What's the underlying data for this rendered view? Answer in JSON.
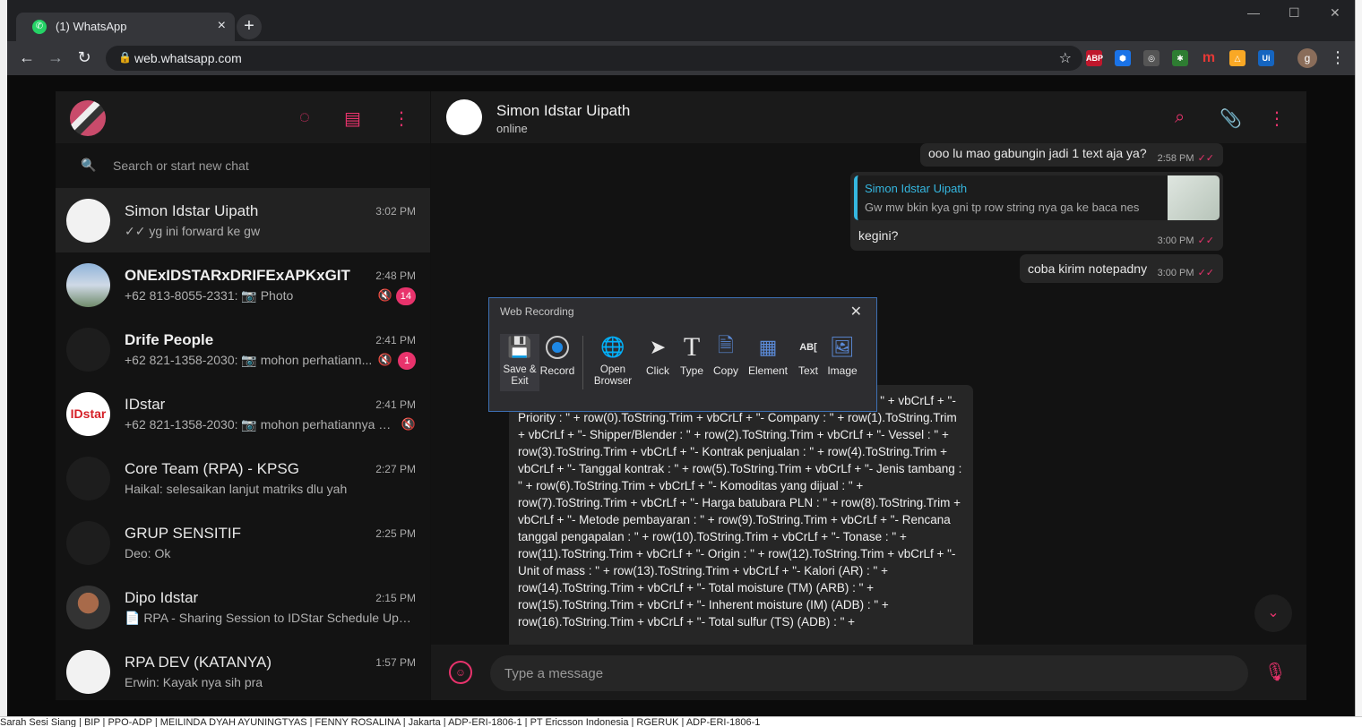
{
  "browser": {
    "tab_title": "(1) WhatsApp",
    "url": "web.whatsapp.com",
    "profile_initial": "g",
    "extensions": [
      "ABP",
      "⬢",
      "◎",
      "✱",
      "m",
      "△",
      "Ui"
    ]
  },
  "sidebar": {
    "search_placeholder": "Search or start new chat",
    "chats": [
      {
        "name": "Simon Idstar Uipath",
        "time": "3:02 PM",
        "preview": "✓✓ yg ini forward ke gw",
        "bold": false
      },
      {
        "name": "ONExIDSTARxDRIFExAPKxGIT",
        "time": "2:48 PM",
        "preview": "+62 813-8055-2331: 📷 Photo",
        "badge": "14",
        "bold": true
      },
      {
        "name": "Drife People",
        "time": "2:41 PM",
        "preview": "+62 821-1358-2030: 📷 mohon perhatiann...",
        "badge": "1",
        "bold": true
      },
      {
        "name": "IDstar",
        "time": "2:41 PM",
        "preview": "+62 821-1358-2030: 📷 mohon perhatiannya u...",
        "bold": false
      },
      {
        "name": "Core Team (RPA) - KPSG",
        "time": "2:27 PM",
        "preview": "Haikal: selesaikan lanjut matriks dlu yah",
        "bold": false
      },
      {
        "name": "GRUP SENSITIF",
        "time": "2:25 PM",
        "preview": "Deo: Ok",
        "bold": false
      },
      {
        "name": "Dipo Idstar",
        "time": "2:15 PM",
        "preview": "📄 RPA - Sharing Session to IDStar Schedule Updat...",
        "bold": false
      },
      {
        "name": "RPA DEV (KATANYA)",
        "time": "1:57 PM",
        "preview": "Erwin: Kayak nya sih pra",
        "bold": false
      }
    ]
  },
  "chat": {
    "contact_name": "Simon Idstar Uipath",
    "contact_status": "online",
    "messages": [
      {
        "text": "ooo lu mao gabungin jadi 1 text aja ya?",
        "time": "2:58 PM"
      },
      {
        "quote_name": "Simon Idstar Uipath",
        "quote_text": "Gw mw bkin kya gni tp row string nya ga ke baca nes",
        "text": "kegini?",
        "time": "3:00 PM"
      },
      {
        "text": "coba kirim notepadny",
        "time": "3:00 PM"
      }
    ],
    "long_message": "priority : \" + row(0).ToString + vbCrLf + vbCrLf + \"Dari data berikut : \" + vbCrLf + \"- Priority : \" + row(0).ToString.Trim + vbCrLf + \"- Company : \" + row(1).ToString.Trim + vbCrLf + \"- Shipper/Blender : \" + row(2).ToString.Trim + vbCrLf + \"- Vessel : \" + row(3).ToString.Trim + vbCrLf + \"- Kontrak penjualan : \" + row(4).ToString.Trim + vbCrLf + \"- Tanggal kontrak : \" + row(5).ToString.Trim + vbCrLf + \"- Jenis tambang : \" + row(6).ToString.Trim + vbCrLf + \"- Komoditas yang dijual : \" + row(7).ToString.Trim + vbCrLf + \"- Harga batubara PLN : \" + row(8).ToString.Trim + vbCrLf + \"- Metode pembayaran : \" + row(9).ToString.Trim + vbCrLf + \"- Rencana tanggal pengapalan : \" + row(10).ToString.Trim + vbCrLf + \"- Tonase : \" + row(11).ToString.Trim + vbCrLf + \"- Origin : \" + row(12).ToString.Trim + vbCrLf + \"- Unit of mass : \" + row(13).ToString.Trim + vbCrLf + \"- Kalori (AR) : \" + row(14).ToString.Trim + vbCrLf + \"- Total moisture (TM) (ARB) : \" + row(15).ToString.Trim + vbCrLf + \"- Inherent moisture (IM) (ADB) : \" + row(16).ToString.Trim + vbCrLf + \"- Total sulfur (TS) (ADB) : \" +",
    "composer_placeholder": "Type a message"
  },
  "recorder": {
    "title": "Web Recording",
    "tools": [
      {
        "label": "Save & Exit",
        "icon": "save-icon"
      },
      {
        "label": "Record",
        "icon": "record-icon"
      },
      {
        "label": "Open Browser",
        "icon": "globe-cursor-icon"
      },
      {
        "label": "Click",
        "icon": "cursor-icon"
      },
      {
        "label": "Type",
        "icon": "type-t-icon"
      },
      {
        "label": "Copy",
        "icon": "copy-doc-icon"
      },
      {
        "label": "Element",
        "icon": "element-grid-icon"
      },
      {
        "label": "Text",
        "icon": "text-abc-icon"
      },
      {
        "label": "Image",
        "icon": "image-icon"
      }
    ]
  },
  "background_sheet": "Sarah Sesi Siang | BIP | PPO-ADP | MEILINDA DYAH AYUNINGTYAS | FENNY ROSALINA | Jakarta | ADP-ERI-1806-1 | PT Ericsson Indonesia | RGERUK | ADP-ERI-1806-1",
  "colors": {
    "accent": "#e8336c",
    "quote_bar": "#35b7e0"
  }
}
